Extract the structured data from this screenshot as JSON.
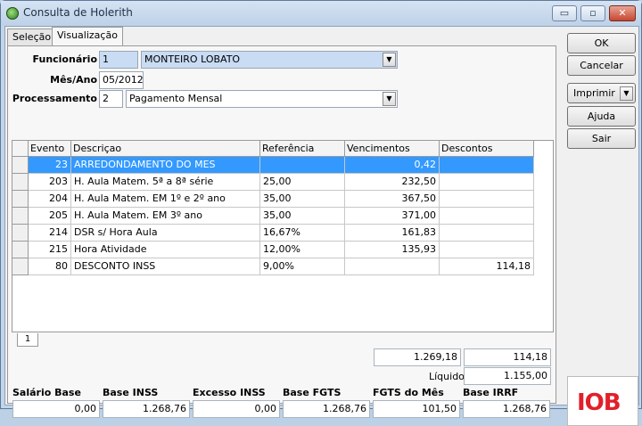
{
  "window": {
    "title": "Consulta de Holerith",
    "minimize": "▭",
    "restore": "▫",
    "close": "✕"
  },
  "tabs": [
    "Seleção",
    "Visualização"
  ],
  "form": {
    "funcionario_label": "Funcionário",
    "funcionario_code": "1",
    "funcionario_name": "MONTEIRO LOBATO",
    "mesano_label": "Mês/Ano",
    "mesano_value": "05/2012",
    "processamento_label": "Processamento",
    "processamento_code": "2",
    "processamento_name": "Pagamento Mensal"
  },
  "grid": {
    "headers": [
      "Evento",
      "Descriçao",
      "Referência",
      "Vencimentos",
      "Descontos"
    ],
    "rows": [
      {
        "evento": "23",
        "descricao": "ARREDONDAMENTO DO MES",
        "referencia": "",
        "vencimentos": "0,42",
        "descontos": ""
      },
      {
        "evento": "203",
        "descricao": "H. Aula Matem. 5ª a 8ª série",
        "referencia": "25,00",
        "vencimentos": "232,50",
        "descontos": ""
      },
      {
        "evento": "204",
        "descricao": "H. Aula Matem. EM 1º e 2º ano",
        "referencia": "35,00",
        "vencimentos": "367,50",
        "descontos": ""
      },
      {
        "evento": "205",
        "descricao": "H. Aula Matem. EM 3º ano",
        "referencia": "35,00",
        "vencimentos": "371,00",
        "descontos": ""
      },
      {
        "evento": "214",
        "descricao": "DSR s/ Hora Aula",
        "referencia": "16,67%",
        "vencimentos": "161,83",
        "descontos": ""
      },
      {
        "evento": "215",
        "descricao": "Hora Atividade",
        "referencia": "12,00%",
        "vencimentos": "135,93",
        "descontos": ""
      },
      {
        "evento": "80",
        "descricao": "DESCONTO INSS",
        "referencia": "9,00%",
        "vencimentos": "",
        "descontos": "114,18"
      }
    ],
    "page": "1"
  },
  "totals": {
    "vencimentos": "1.269,18",
    "descontos": "114,18",
    "liquido_label": "Líquido",
    "liquido": "1.155,00"
  },
  "bases": [
    {
      "label": "Salário Base",
      "value": "0,00"
    },
    {
      "label": "Base INSS",
      "value": "1.268,76"
    },
    {
      "label": "Excesso INSS",
      "value": "0,00"
    },
    {
      "label": "Base FGTS",
      "value": "1.268,76"
    },
    {
      "label": "FGTS do Mês",
      "value": "101,50"
    },
    {
      "label": "Base IRRF",
      "value": "1.268,76"
    }
  ],
  "buttons": {
    "ok": "OK",
    "cancelar": "Cancelar",
    "imprimir": "Imprimir",
    "ajuda": "Ajuda",
    "sair": "Sair"
  },
  "logo": "IOB",
  "colors": {
    "selection": "#3399ff",
    "logo_red": "#e21f2a"
  }
}
